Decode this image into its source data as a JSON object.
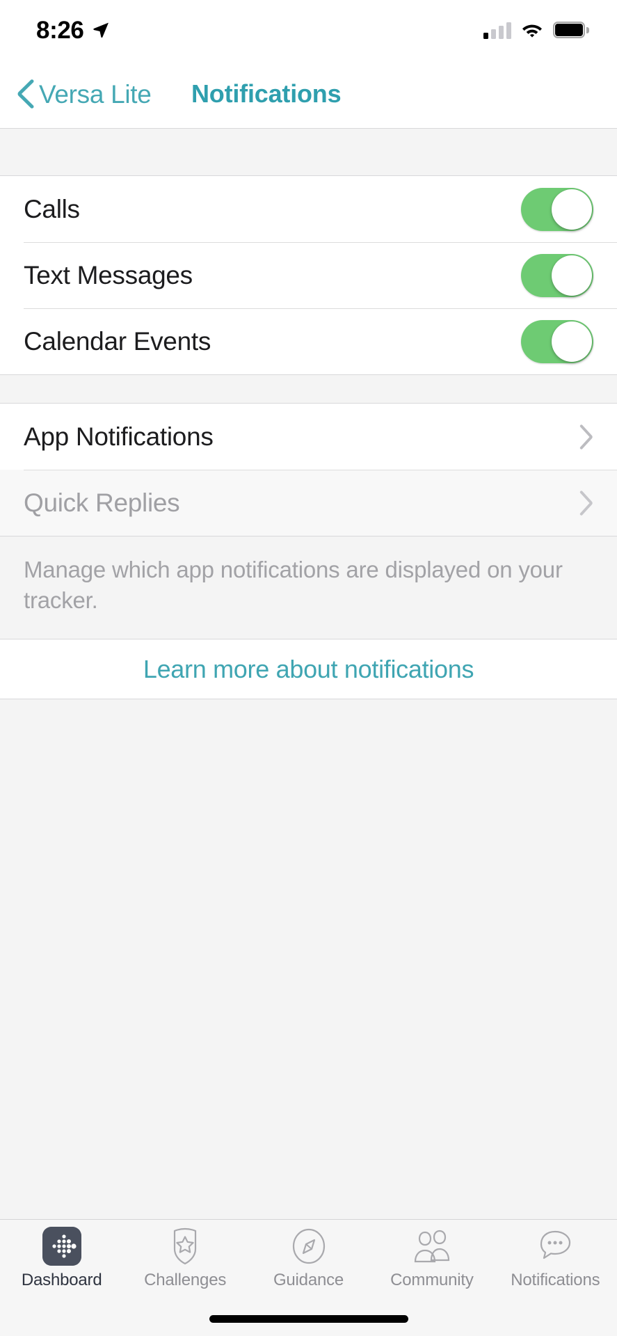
{
  "status_bar": {
    "time": "8:26",
    "location_icon": "location-arrow-icon",
    "signal_icon": "cellular-signal-icon",
    "signal_bars_filled": 1,
    "signal_bars_total": 4,
    "wifi_icon": "wifi-icon",
    "battery_icon": "battery-full-icon",
    "battery_level_percent": 100
  },
  "nav_bar": {
    "back_icon": "chevron-left-icon",
    "back_label": "Versa Lite",
    "title": "Notifications",
    "accent_color": "#3fa5b2"
  },
  "sections": {
    "toggles": {
      "rows": [
        {
          "label": "Calls",
          "enabled": true,
          "control": "switch"
        },
        {
          "label": "Text Messages",
          "enabled": true,
          "control": "switch"
        },
        {
          "label": "Calendar Events",
          "enabled": true,
          "control": "switch"
        }
      ],
      "switch_on_color": "#6ecb73",
      "switch_knob_color": "#ffffff"
    },
    "links": {
      "rows": [
        {
          "label": "App Notifications",
          "disabled": false,
          "accessory_icon": "chevron-right-icon"
        },
        {
          "label": "Quick Replies",
          "disabled": true,
          "accessory_icon": "chevron-right-icon"
        }
      ],
      "description": "Manage which app notifications are displayed on your tracker."
    },
    "learn_more": {
      "label": "Learn more about notifications"
    }
  },
  "tab_bar": {
    "tabs": [
      {
        "label": "Dashboard",
        "icon": "fitbit-dots-logo-icon",
        "active": true
      },
      {
        "label": "Challenges",
        "icon": "star-shield-icon",
        "active": false
      },
      {
        "label": "Guidance",
        "icon": "compass-icon",
        "active": false
      },
      {
        "label": "Community",
        "icon": "people-icon",
        "active": false
      },
      {
        "label": "Notifications",
        "icon": "speech-bubble-dots-icon",
        "active": false
      }
    ],
    "home_indicator": "home-indicator"
  }
}
